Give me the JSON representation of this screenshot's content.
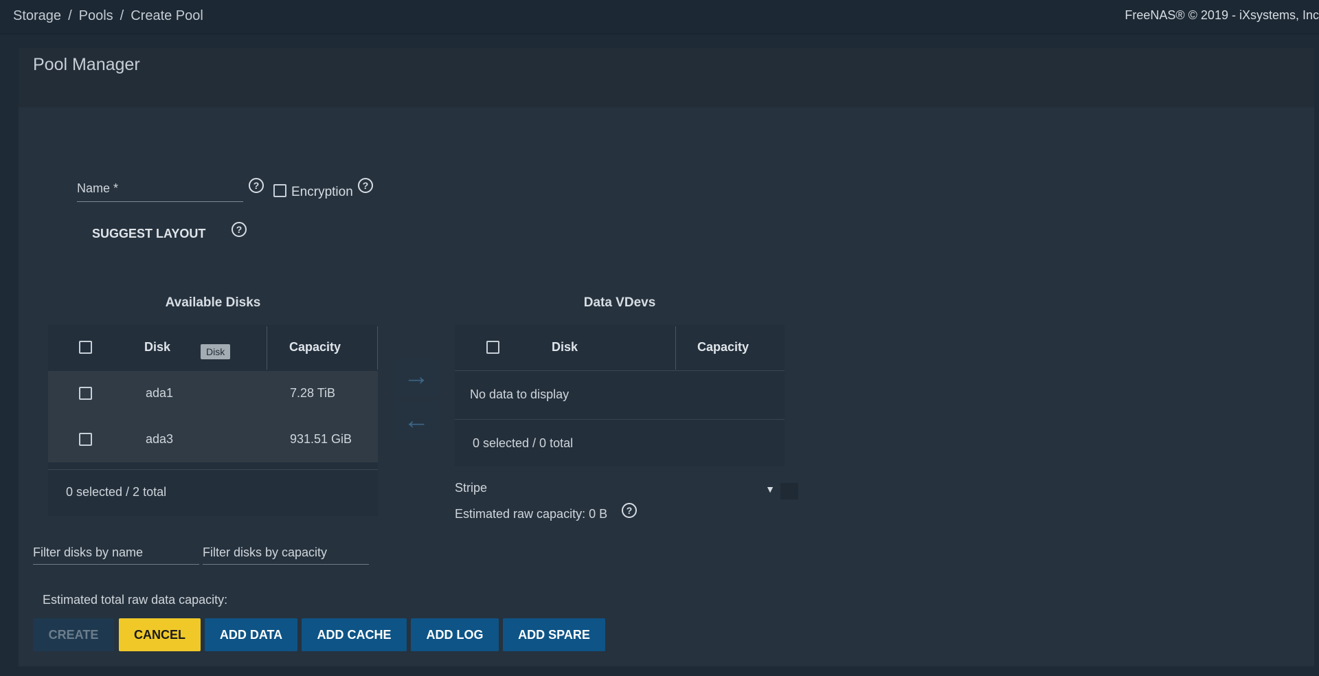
{
  "breadcrumb": [
    "Storage",
    "Pools",
    "Create Pool"
  ],
  "copyright": "FreeNAS® © 2019 - iXsystems, Inc",
  "card_title": "Pool Manager",
  "form": {
    "name_label": "Name *",
    "encryption_label": "Encryption",
    "suggest_layout_label": "SUGGEST LAYOUT"
  },
  "available_disks": {
    "heading": "Available Disks",
    "col_disk": "Disk",
    "col_capacity": "Capacity",
    "tooltip": "Disk",
    "rows": [
      {
        "disk": "ada1",
        "capacity": "7.28 TiB"
      },
      {
        "disk": "ada3",
        "capacity": "931.51 GiB"
      }
    ],
    "footer": "0 selected / 2 total"
  },
  "data_vdevs": {
    "heading": "Data VDevs",
    "col_disk": "Disk",
    "col_capacity": "Capacity",
    "empty_text": "No data to display",
    "footer": "0 selected / 0 total",
    "layout_select": "Stripe",
    "estimated_raw": "Estimated raw capacity: 0 B"
  },
  "filters": {
    "by_name": "Filter disks by name",
    "by_capacity": "Filter disks by capacity"
  },
  "estimated_total": "Estimated total raw data capacity:",
  "buttons": {
    "create": "CREATE",
    "cancel": "CANCEL",
    "add_data": "ADD DATA",
    "add_cache": "ADD CACHE",
    "add_log": "ADD LOG",
    "add_spare": "ADD SPARE"
  },
  "icons": {
    "help": "help-circle-icon",
    "arrow_right": "arrow-right-icon",
    "arrow_left": "arrow-left-icon",
    "dropdown": "caret-down-icon"
  },
  "colors": {
    "accent": "#0e5486",
    "cancel": "#f0c929",
    "background": "#1e2a36"
  }
}
